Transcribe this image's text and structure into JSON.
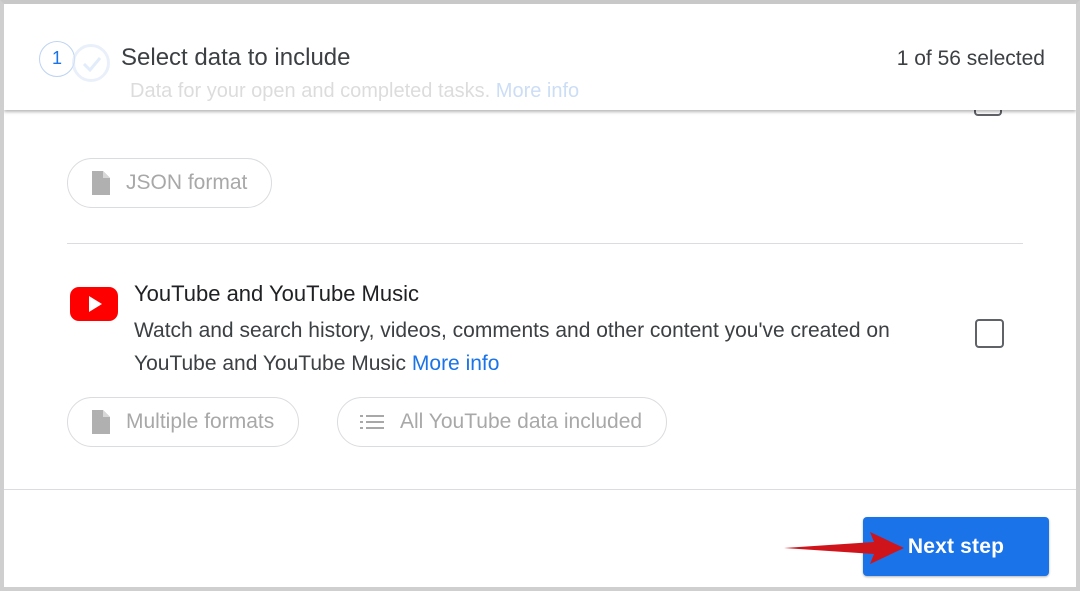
{
  "header": {
    "step_number": "1",
    "title": "Select data to include",
    "selected_count": "1 of 56 selected"
  },
  "tasks_item": {
    "description": "Data for your open and completed tasks.",
    "more_info": "More info",
    "format_chip": "JSON format"
  },
  "youtube_item": {
    "title": "YouTube and YouTube Music",
    "description": "Watch and search history, videos, comments and other content you've created on YouTube and YouTube Music",
    "more_info": "More info",
    "format_chip": "Multiple formats",
    "data_chip": "All YouTube data included"
  },
  "footer": {
    "next_label": "Next step"
  },
  "colors": {
    "accent": "#1a73e8",
    "youtube_red": "#ff0000",
    "arrow_red": "#d0141b"
  }
}
